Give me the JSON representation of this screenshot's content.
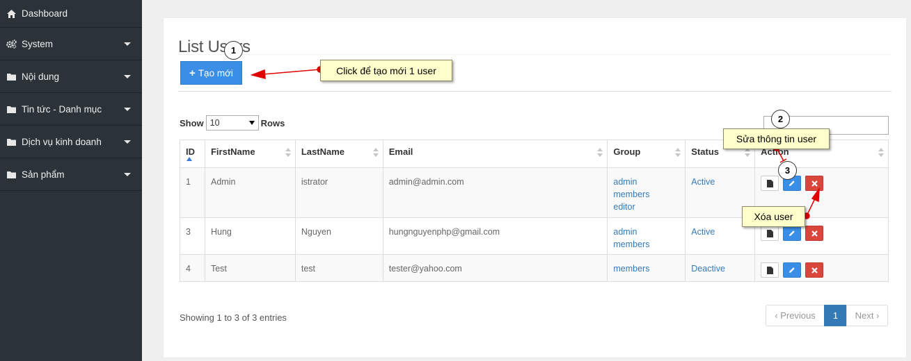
{
  "sidebar": {
    "items": [
      {
        "label": "Dashboard",
        "icon": "home-icon"
      },
      {
        "label": "System",
        "icon": "gears-icon"
      },
      {
        "label": "Nội dung",
        "icon": "folder-icon"
      },
      {
        "label": "Tin tức - Danh mục",
        "icon": "folder-icon"
      },
      {
        "label": "Dịch vụ kinh doanh",
        "icon": "folder-icon"
      },
      {
        "label": "Sản phẩm",
        "icon": "folder-icon"
      }
    ]
  },
  "main": {
    "title": "List Users",
    "create_button": "Tạo mới",
    "show_label": "Show",
    "rows_label": "Rows",
    "page_size": "10",
    "search_value": "",
    "columns": [
      "ID",
      "FirstName",
      "LastName",
      "Email",
      "Group",
      "Status",
      "Action"
    ],
    "rows": [
      {
        "id": "1",
        "first": "Admin",
        "last": "istrator",
        "email": "admin@admin.com",
        "groups": [
          "admin",
          "members",
          "editor"
        ],
        "status": "Active"
      },
      {
        "id": "3",
        "first": "Hung",
        "last": "Nguyen",
        "email": "hungnguyenphp@gmail.com",
        "groups": [
          "admin",
          "members"
        ],
        "status": "Active"
      },
      {
        "id": "4",
        "first": "Test",
        "last": "test",
        "email": "tester@yahoo.com",
        "groups": [
          "members"
        ],
        "status": "Deactive"
      }
    ],
    "info": "Showing 1 to 3 of 3 entries",
    "pagination": {
      "previous": "Previous",
      "current": "1",
      "next": "Next"
    }
  },
  "annotations": {
    "n1": "1",
    "n2": "2",
    "n3": "3",
    "create_note": "Click để tạo mới 1 user",
    "edit_note": "Sửa thông tin user",
    "delete_note": "Xóa user"
  },
  "colors": {
    "sidebar_bg": "#2c3338",
    "primary": "#3a8ee6",
    "danger": "#d9463b",
    "link": "#337ab7",
    "callout_bg": "#ffffcc",
    "arrow": "#e00000"
  }
}
